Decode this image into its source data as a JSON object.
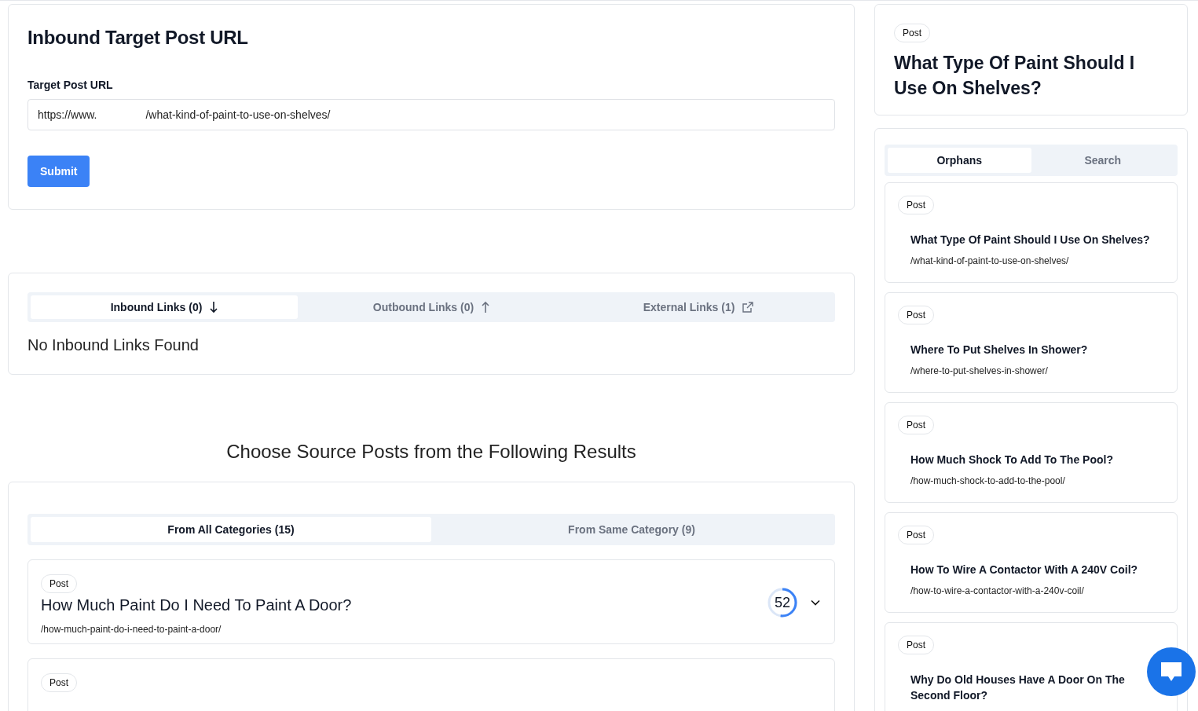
{
  "target_form": {
    "title": "Inbound Target Post URL",
    "label": "Target Post URL",
    "value_prefix": "https://www.",
    "value_suffix": "/what-kind-of-paint-to-use-on-shelves/",
    "submit": "Submit"
  },
  "link_tabs": [
    {
      "label": "Inbound Links (0)",
      "kind": "inbound",
      "selected": true
    },
    {
      "label": "Outbound Links (0)",
      "kind": "outbound",
      "selected": false
    },
    {
      "label": "External Links (1)",
      "kind": "external",
      "selected": false
    }
  ],
  "links_empty": "No Inbound Links Found",
  "results_heading": "Choose Source Posts from the Following Results",
  "result_tabs": [
    {
      "label": "From All Categories (15)",
      "selected": true
    },
    {
      "label": "From Same Category (9)",
      "selected": false
    }
  ],
  "results": [
    {
      "badge": "Post",
      "title": "How Much Paint Do I Need To Paint A Door?",
      "url": "/how-much-paint-do-i-need-to-paint-a-door/",
      "score": "52",
      "level": 0.52
    },
    {
      "badge": "Post"
    }
  ],
  "current_post": {
    "badge": "Post",
    "title": "What Type Of Paint Should I Use On Shelves?"
  },
  "side_tabs": [
    {
      "label": "Orphans",
      "selected": true
    },
    {
      "label": "Search",
      "selected": false
    }
  ],
  "orphans": [
    {
      "badge": "Post",
      "title": "What Type Of Paint Should I Use On Shelves?",
      "url": "/what-kind-of-paint-to-use-on-shelves/"
    },
    {
      "badge": "Post",
      "title": "Where To Put Shelves In Shower?",
      "url": "/where-to-put-shelves-in-shower/"
    },
    {
      "badge": "Post",
      "title": "How Much Shock To Add To The Pool?",
      "url": "/how-much-shock-to-add-to-the-pool/"
    },
    {
      "badge": "Post",
      "title": "How To Wire A Contactor With A 240V Coil?",
      "url": "/how-to-wire-a-contactor-with-a-240v-coil/"
    },
    {
      "badge": "Post",
      "title": "Why Do Old Houses Have A Door On The Second Floor?"
    }
  ]
}
